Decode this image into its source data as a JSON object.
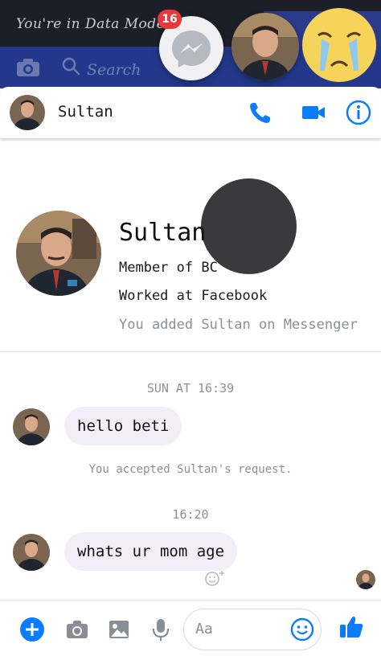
{
  "status": {
    "data_mode_text": "You're in Data Mode"
  },
  "search": {
    "placeholder": "Search"
  },
  "chat_heads": {
    "unread_count": "16"
  },
  "header": {
    "contact_name": "Sultan"
  },
  "profile": {
    "name": "Sultan",
    "member_of": "Member of BC",
    "worked_at": "Worked at Facebook",
    "added_note": "You added Sultan on Messenger"
  },
  "messages": {
    "day_stamp": "SUN AT 16:39",
    "first": "hello beti",
    "system_note": "You accepted Sultan's request.",
    "time_stamp": "16:20",
    "second": "whats ur mom age"
  },
  "composer": {
    "placeholder": "Aa"
  },
  "colors": {
    "accent": "#0a7cff",
    "header_band": "#24388b",
    "bubble": "#f1eef7",
    "badge": "#e8393a"
  },
  "icons": [
    "camera-icon",
    "search-icon",
    "messenger-icon",
    "phone-icon",
    "video-icon",
    "info-icon",
    "plus-icon",
    "image-icon",
    "mic-icon",
    "emoji-icon",
    "like-icon",
    "add-reaction-icon"
  ]
}
